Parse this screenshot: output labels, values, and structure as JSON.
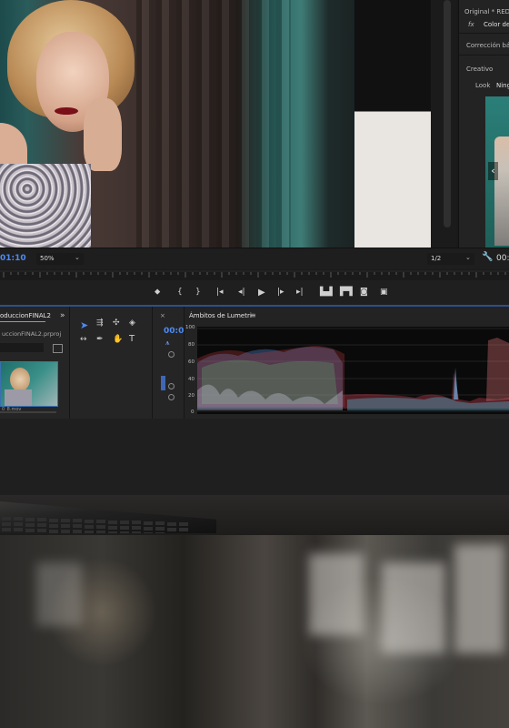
{
  "effect_controls": {
    "header": "Original * RED",
    "fx_label": "fx",
    "fx_item": "Color de",
    "section_basic": "Corrección básic",
    "section_creative": "Creativo",
    "look_label": "Look",
    "look_value": "Ning"
  },
  "program_monitor": {
    "timecode": "01:10",
    "zoom": "50%",
    "resolution": "1/2",
    "right_timecode": "00:"
  },
  "project_panel": {
    "title": "oduccionFINAL2",
    "file": "uccionFINAL2.prproj",
    "clip_name": "0_8.mov"
  },
  "timeline_panel": {
    "timecode": "00:0"
  },
  "lumetri": {
    "title": "Ámbitos de Lumetri",
    "scale": [
      "100",
      "80",
      "60",
      "40",
      "20",
      "0"
    ]
  },
  "colors": {
    "accent_blue": "#4c8bf5",
    "selection_blue": "#2d4f87"
  },
  "icons": {
    "transport": [
      "mark-in-icon",
      "in-bracket-icon",
      "out-bracket-icon",
      "go-to-in-icon",
      "step-back-icon",
      "play-icon",
      "step-forward-icon",
      "go-to-out-icon",
      "insert-icon",
      "overwrite-icon",
      "export-frame-icon",
      "compare-icon"
    ]
  }
}
